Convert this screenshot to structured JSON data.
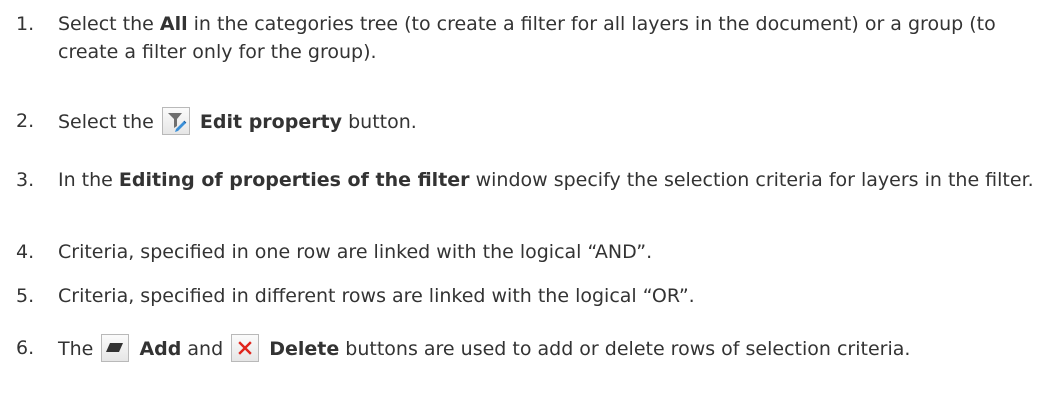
{
  "steps": [
    {
      "number": "1.",
      "parts": [
        {
          "text": "Select the "
        },
        {
          "text": "All",
          "bold": true
        },
        {
          "text": " in the categories tree (to create a filter for all layers in the document) or a group (to create a filter only for the group)."
        }
      ]
    },
    {
      "number": "2.",
      "parts": [
        {
          "text": "Select the "
        },
        {
          "icon": "edit-filter-icon"
        },
        {
          "text": " "
        },
        {
          "text": "Edit property",
          "bold": true
        },
        {
          "text": " button."
        }
      ]
    },
    {
      "number": "3.",
      "parts": [
        {
          "text": "In the "
        },
        {
          "text": "Editing of properties of the filter",
          "bold": true
        },
        {
          "text": " window specify the selection criteria for layers in the filter."
        }
      ]
    },
    {
      "number": "4.",
      "parts": [
        {
          "text": "Criteria, specified in one row are linked with the logical “AND”."
        }
      ]
    },
    {
      "number": "5.",
      "parts": [
        {
          "text": "Criteria, specified in different rows are linked with the logical “OR”."
        }
      ]
    },
    {
      "number": "6.",
      "parts": [
        {
          "text": "The "
        },
        {
          "icon": "add-row-icon"
        },
        {
          "text": " "
        },
        {
          "text": "Add",
          "bold": true
        },
        {
          "text": " and "
        },
        {
          "icon": "delete-icon"
        },
        {
          "text": " "
        },
        {
          "text": "Delete",
          "bold": true
        },
        {
          "text": " buttons are used to add or delete rows of selection criteria."
        }
      ]
    }
  ]
}
